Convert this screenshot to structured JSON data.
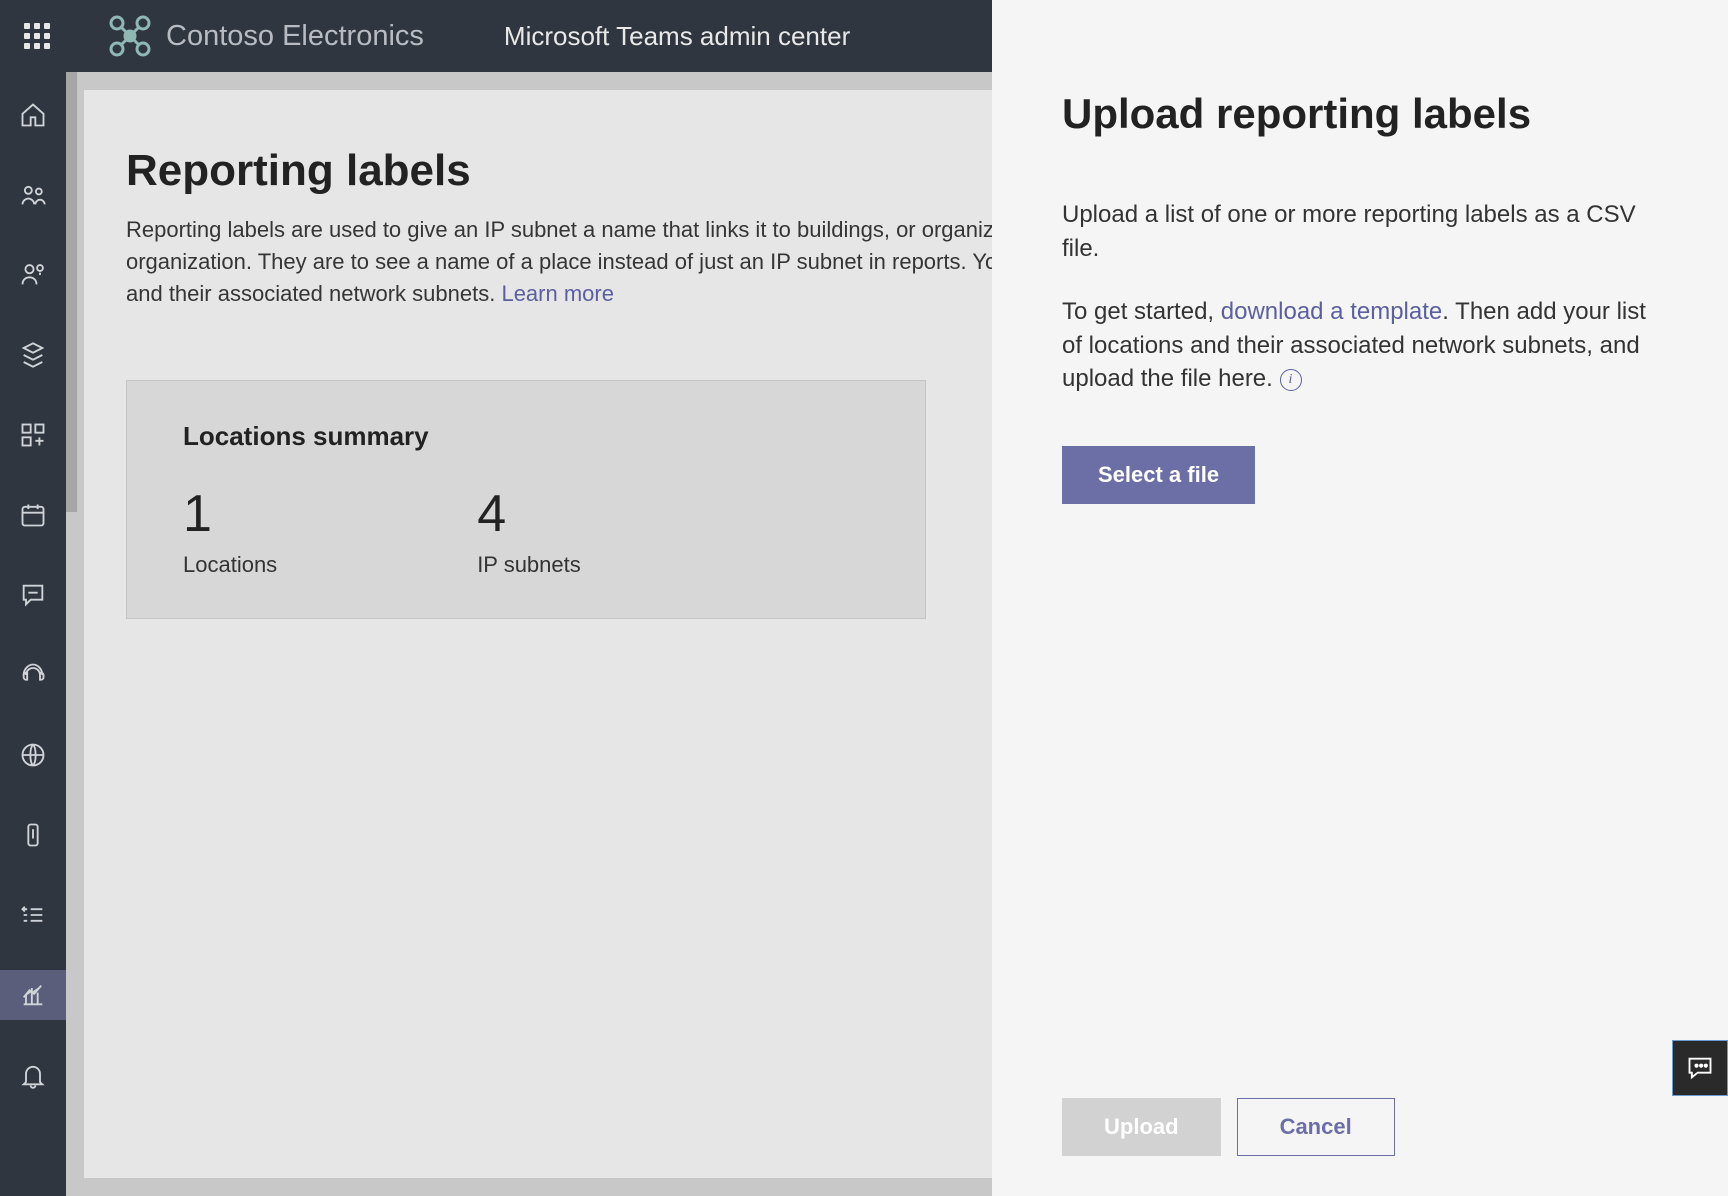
{
  "header": {
    "brand": "Contoso Electronics",
    "app": "Microsoft Teams admin center"
  },
  "page": {
    "title": "Reporting labels",
    "description_prefix": "Reporting labels are used to give an IP subnet a name that links it to buildings, or organizational sites within your organization. They are to see a name of a place instead of just an IP subnet in reports. You physical locations and their associated network subnets. ",
    "learn_more": "Learn more"
  },
  "summary": {
    "title": "Locations summary",
    "stats": [
      {
        "value": "1",
        "label": "Locations"
      },
      {
        "value": "4",
        "label": "IP subnets"
      }
    ]
  },
  "panel": {
    "title": "Upload reporting labels",
    "p1": "Upload a list of one or more reporting labels as a CSV file.",
    "p2_prefix": "To get started, ",
    "p2_link": "download a template",
    "p2_suffix": ". Then add your list of locations and their associated network subnets, and upload the file here. ",
    "select_btn": "Select a file",
    "upload_btn": "Upload",
    "cancel_btn": "Cancel"
  }
}
